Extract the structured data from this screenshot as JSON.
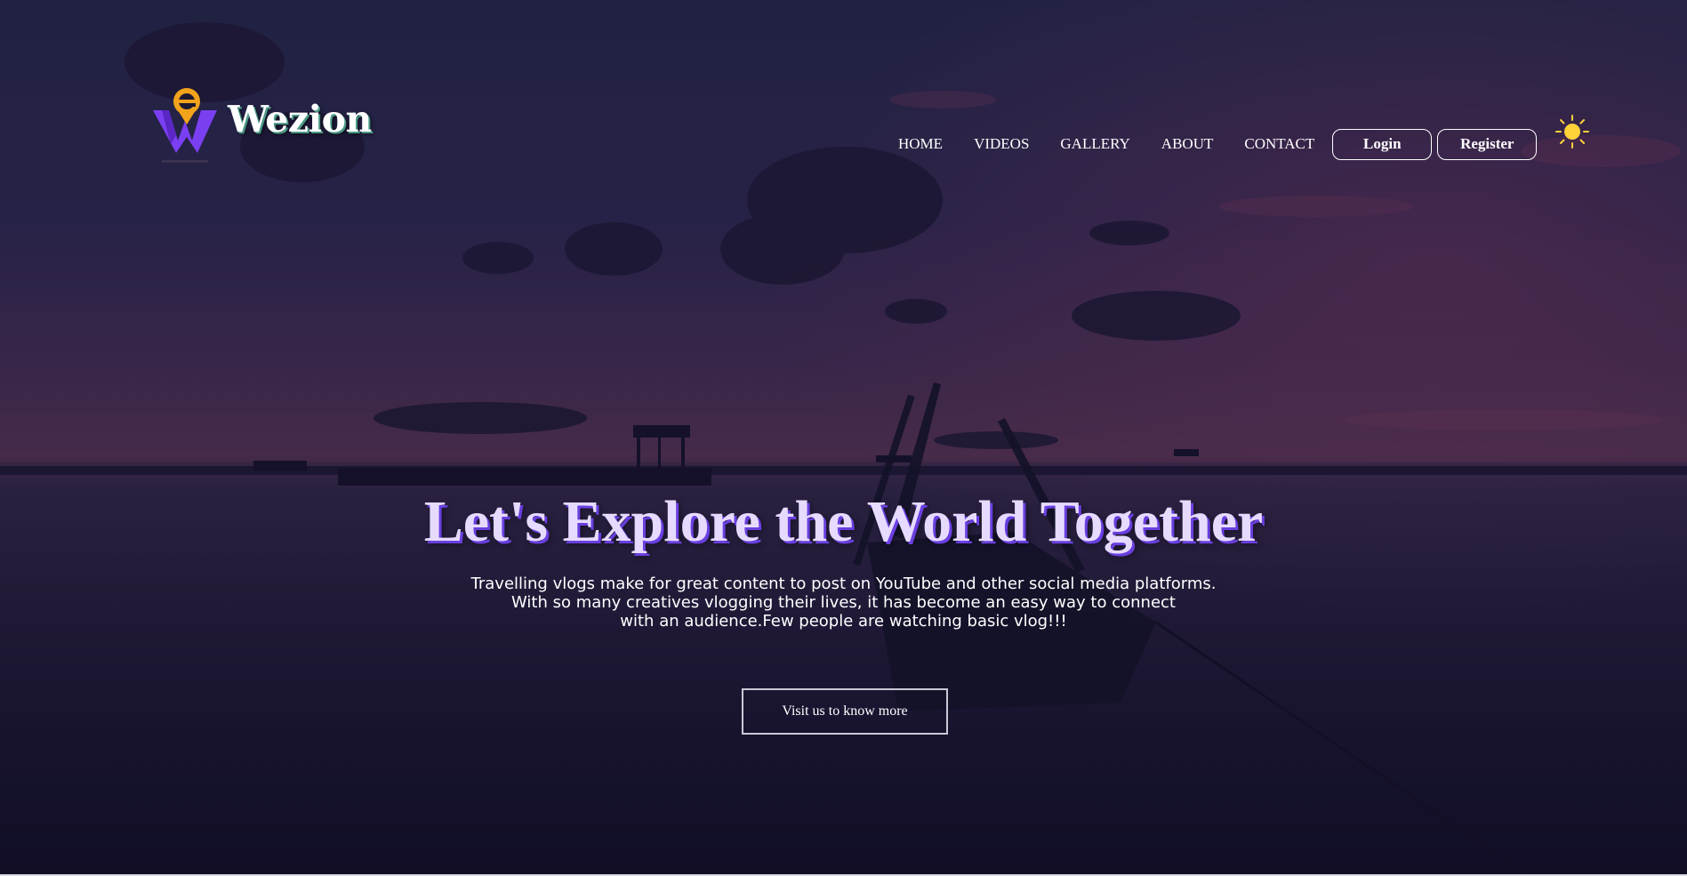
{
  "header": {
    "brand_name": "Wezion",
    "logo_icon": "location-pin-w-logo",
    "theme_toggle_icon": "sun-icon"
  },
  "nav": {
    "items": [
      "HOME",
      "VIDEOS",
      "GALLERY",
      "ABOUT",
      "CONTACT"
    ],
    "login_label": "Login",
    "register_label": "Register"
  },
  "hero": {
    "title": "Let's Explore the World Together",
    "description_lines": [
      "Travelling vlogs make for great content to post on YouTube and other social media platforms.",
      "With so many creatives vlogging their lives, it has become an easy way to connect",
      "with an audience.Few people are watching basic vlog!!!"
    ],
    "cta_label": "Visit us to know more"
  },
  "colors": {
    "brand_purple": "#7b3ff2",
    "logo_orange": "#f2a21b",
    "sun_yellow": "#ffd23a",
    "title_lavender": "#e6dbff"
  }
}
